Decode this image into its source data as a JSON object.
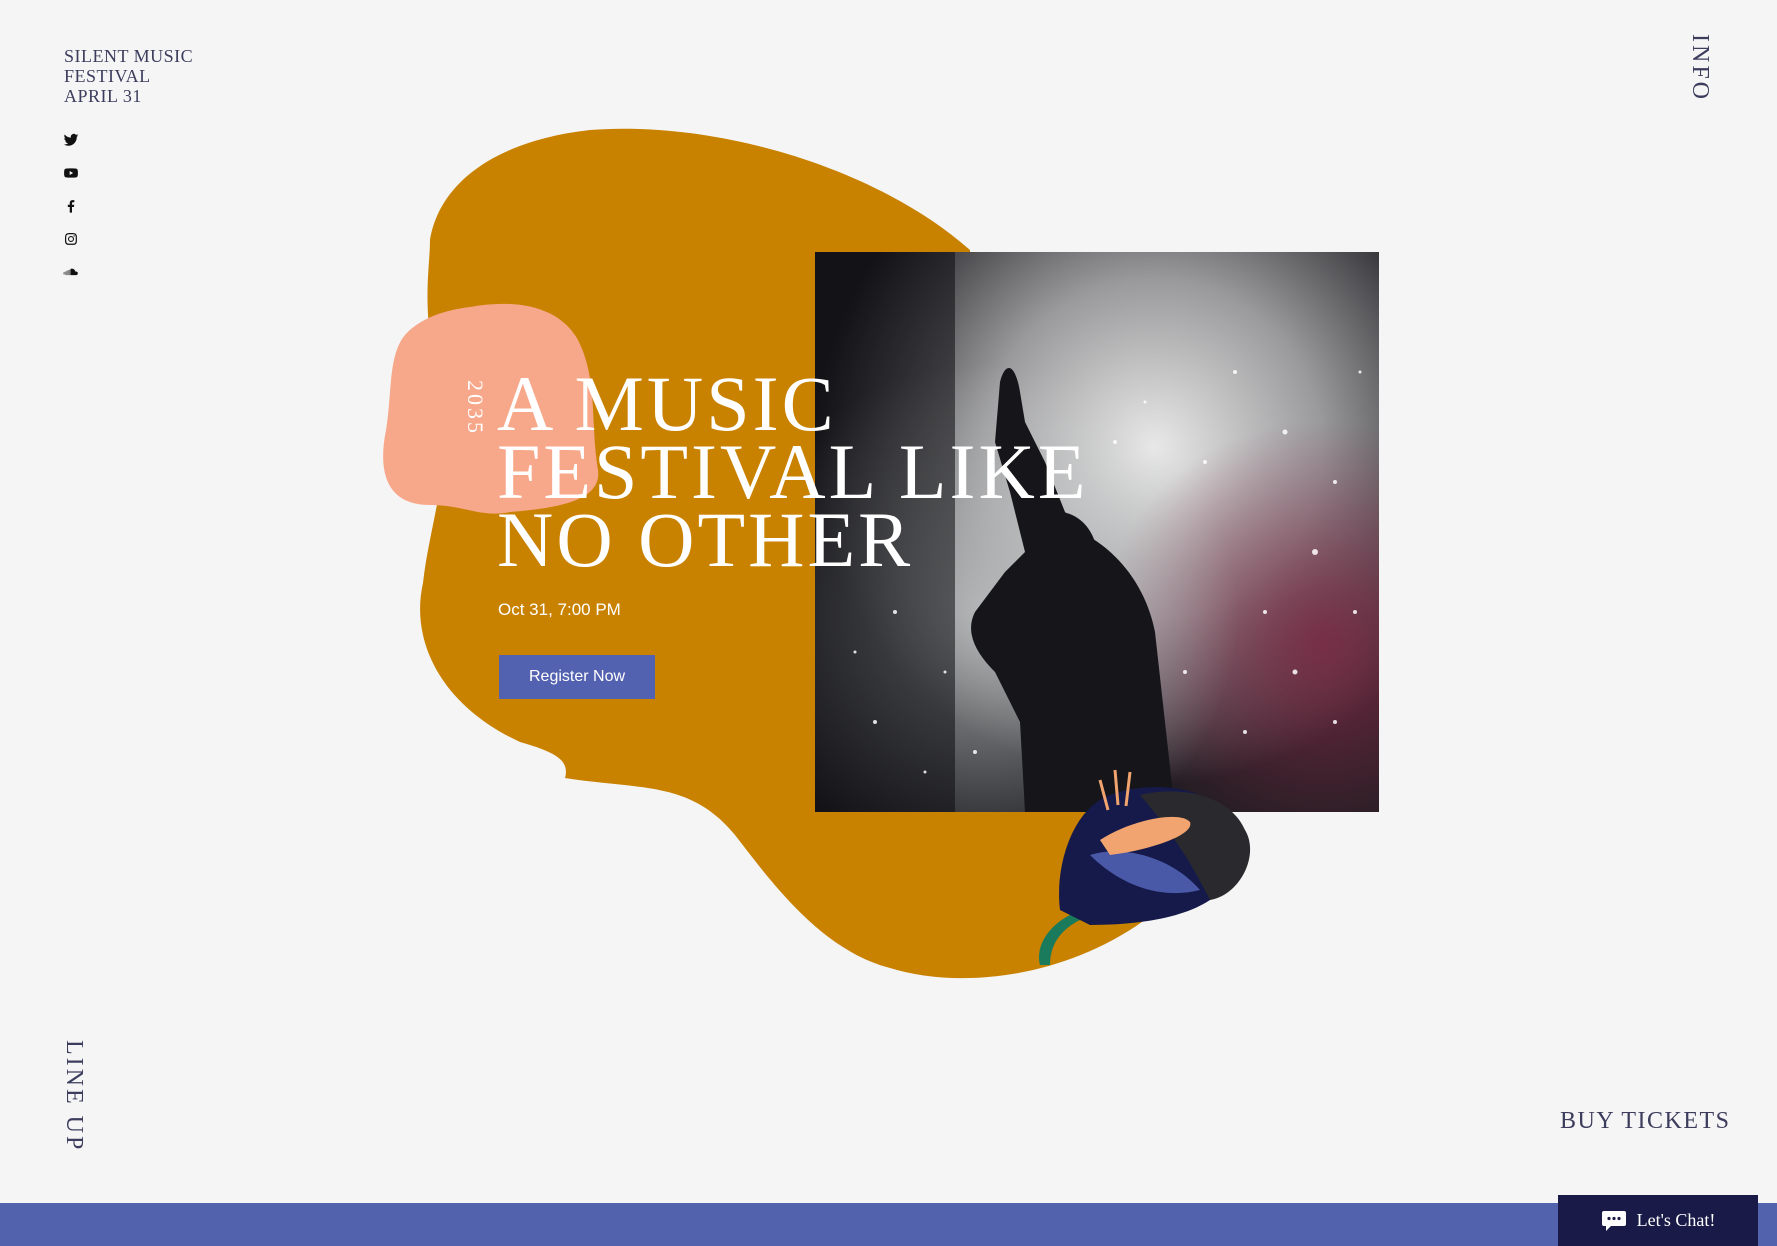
{
  "header": {
    "logo_lines": [
      "SILENT MUSIC",
      "FESTIVAL",
      "APRIL 31"
    ]
  },
  "social": [
    {
      "name": "twitter-icon"
    },
    {
      "name": "youtube-icon"
    },
    {
      "name": "facebook-icon"
    },
    {
      "name": "instagram-icon"
    },
    {
      "name": "soundcloud-icon"
    }
  ],
  "nav": {
    "info": "INFO",
    "lineup": "LINE UP",
    "tickets": "BUY TICKETS"
  },
  "hero": {
    "year": "2035",
    "headline_lines": [
      "A MUSIC",
      "FESTIVAL LIKE",
      "NO OTHER"
    ],
    "date": "Oct 31, 7:00 PM",
    "register_label": "Register Now"
  },
  "chat": {
    "label": "Let's Chat!"
  },
  "colors": {
    "background": "#f5f5f6",
    "blob_gold": "#c98200",
    "blob_peach": "#f8a88a",
    "accent_blue": "#5362b0",
    "chat_navy": "#191a47",
    "text_dark": "#3c3d5c"
  }
}
